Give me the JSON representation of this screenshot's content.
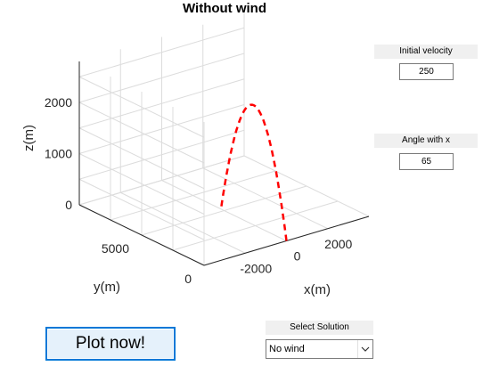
{
  "window": {
    "title": ""
  },
  "plot": {
    "title": "Without wind",
    "xlabel": "x(m)",
    "ylabel": "y(m)",
    "zlabel": "z(m)",
    "xticks": [
      "-2000",
      "0",
      "2000"
    ],
    "yticks": [
      "0",
      "5000"
    ],
    "zticks": [
      "0",
      "1000",
      "2000"
    ],
    "grid": true,
    "colors": {
      "trajectory": "#ff0000",
      "grid": "#dcdcdc",
      "axis": "#262626"
    }
  },
  "chart_data": {
    "type": "line",
    "title": "Without wind",
    "xlabel": "x(m)",
    "ylabel": "y(m)",
    "zlabel": "z(m)",
    "xlim": [
      -4000,
      4000
    ],
    "ylim": [
      0,
      10000
    ],
    "zlim": [
      0,
      2500
    ],
    "grid": true,
    "series": [
      {
        "style": "dashed",
        "color": "#ff0000",
        "x": [
          0,
          0,
          0,
          0,
          0,
          0,
          0,
          0,
          0,
          0,
          0
        ],
        "y": [
          0,
          525,
          1050,
          1575,
          2100,
          2625,
          3150,
          3675,
          4200,
          4725,
          5250
        ],
        "z": [
          0,
          842,
          1497,
          1965,
          2245,
          2339,
          2245,
          1965,
          1497,
          842,
          0
        ]
      }
    ]
  },
  "controls": {
    "velocity_label": "Initial velocity",
    "velocity_value": "250",
    "angle_label": "Angle with x",
    "angle_value": "65",
    "plot_button": "Plot now!",
    "solution_label": "Select Solution",
    "solution_value": "No wind"
  }
}
